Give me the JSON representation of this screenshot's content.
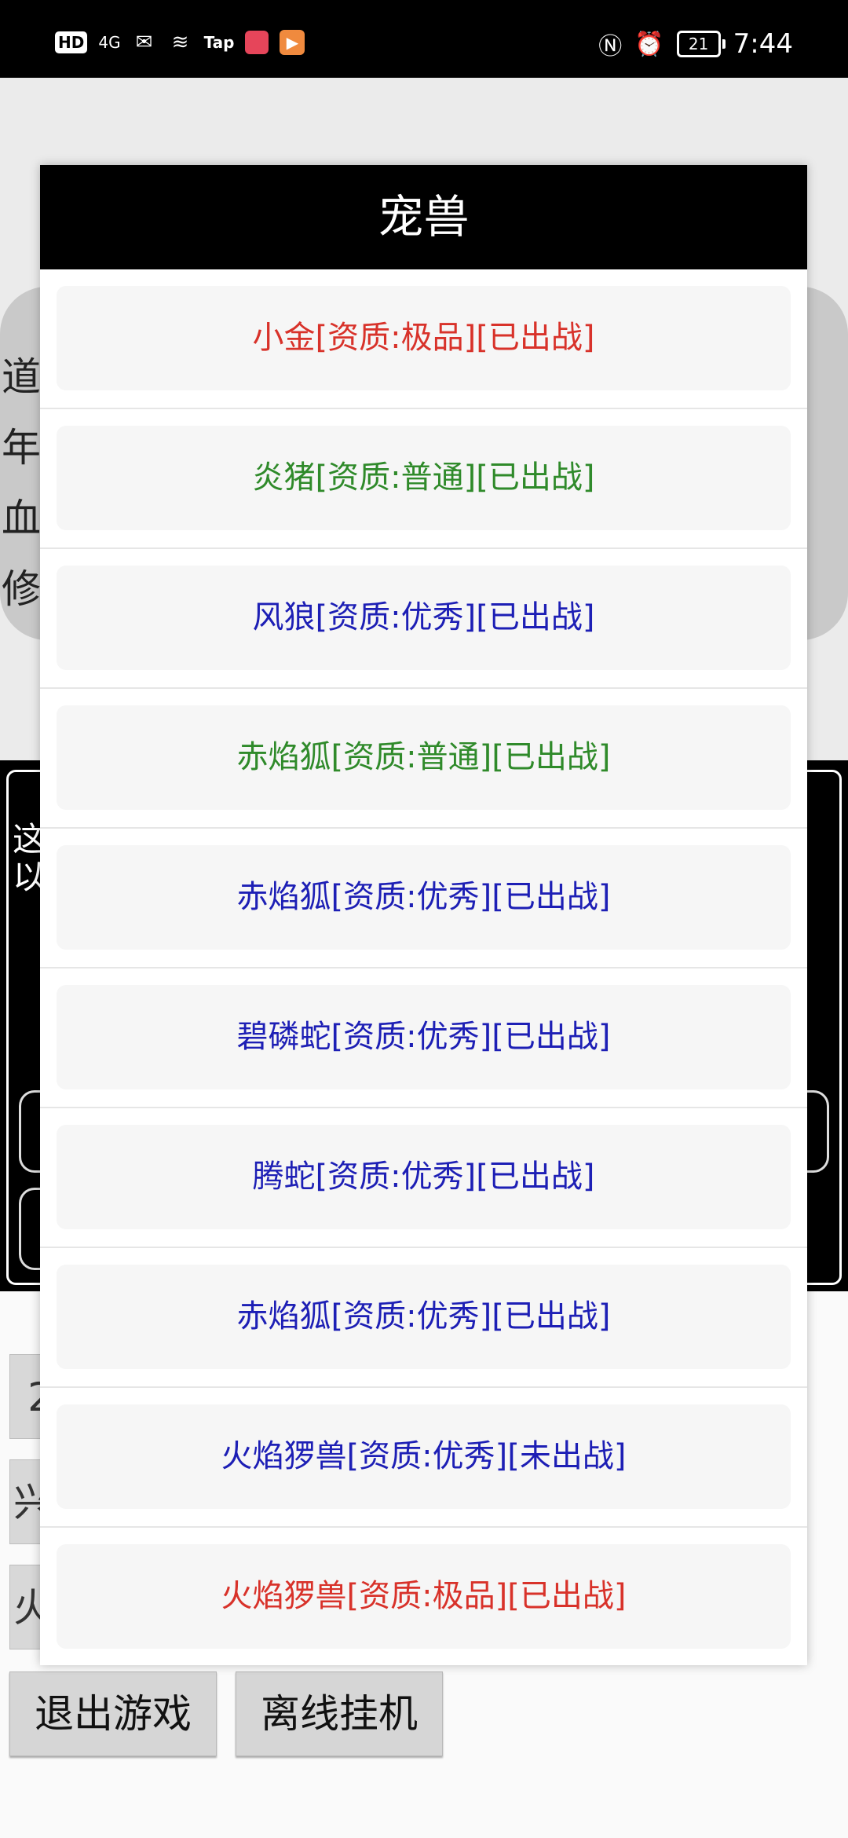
{
  "status_bar": {
    "hd": "HD",
    "signal": "4G",
    "tap": "Tap",
    "battery": "21",
    "time": "7:44"
  },
  "background": {
    "stats": [
      "道",
      "年",
      "血",
      "修"
    ],
    "black_text": [
      "这",
      "以"
    ],
    "stub_labels": [
      "2",
      "兴",
      "火"
    ],
    "buttons": {
      "exit": "退出游戏",
      "offline": "离线挂机"
    }
  },
  "colors": {
    "red": "#d8322a",
    "green": "#2f8a2a",
    "blue": "#1d1fb5"
  },
  "dialog": {
    "title": "宠兽",
    "pets": [
      {
        "label": "小金[资质:极品][已出战]",
        "color": "#d8322a"
      },
      {
        "label": "炎猪[资质:普通][已出战]",
        "color": "#2f8a2a"
      },
      {
        "label": "风狼[资质:优秀][已出战]",
        "color": "#1d1fb5"
      },
      {
        "label": "赤焰狐[资质:普通][已出战]",
        "color": "#2f8a2a"
      },
      {
        "label": "赤焰狐[资质:优秀][已出战]",
        "color": "#1d1fb5"
      },
      {
        "label": "碧磷蛇[资质:优秀][已出战]",
        "color": "#1d1fb5"
      },
      {
        "label": "腾蛇[资质:优秀][已出战]",
        "color": "#1d1fb5"
      },
      {
        "label": "赤焰狐[资质:优秀][已出战]",
        "color": "#1d1fb5"
      },
      {
        "label": "火焰猡兽[资质:优秀][未出战]",
        "color": "#1d1fb5"
      },
      {
        "label": "火焰猡兽[资质:极品][已出战]",
        "color": "#d8322a"
      }
    ]
  }
}
